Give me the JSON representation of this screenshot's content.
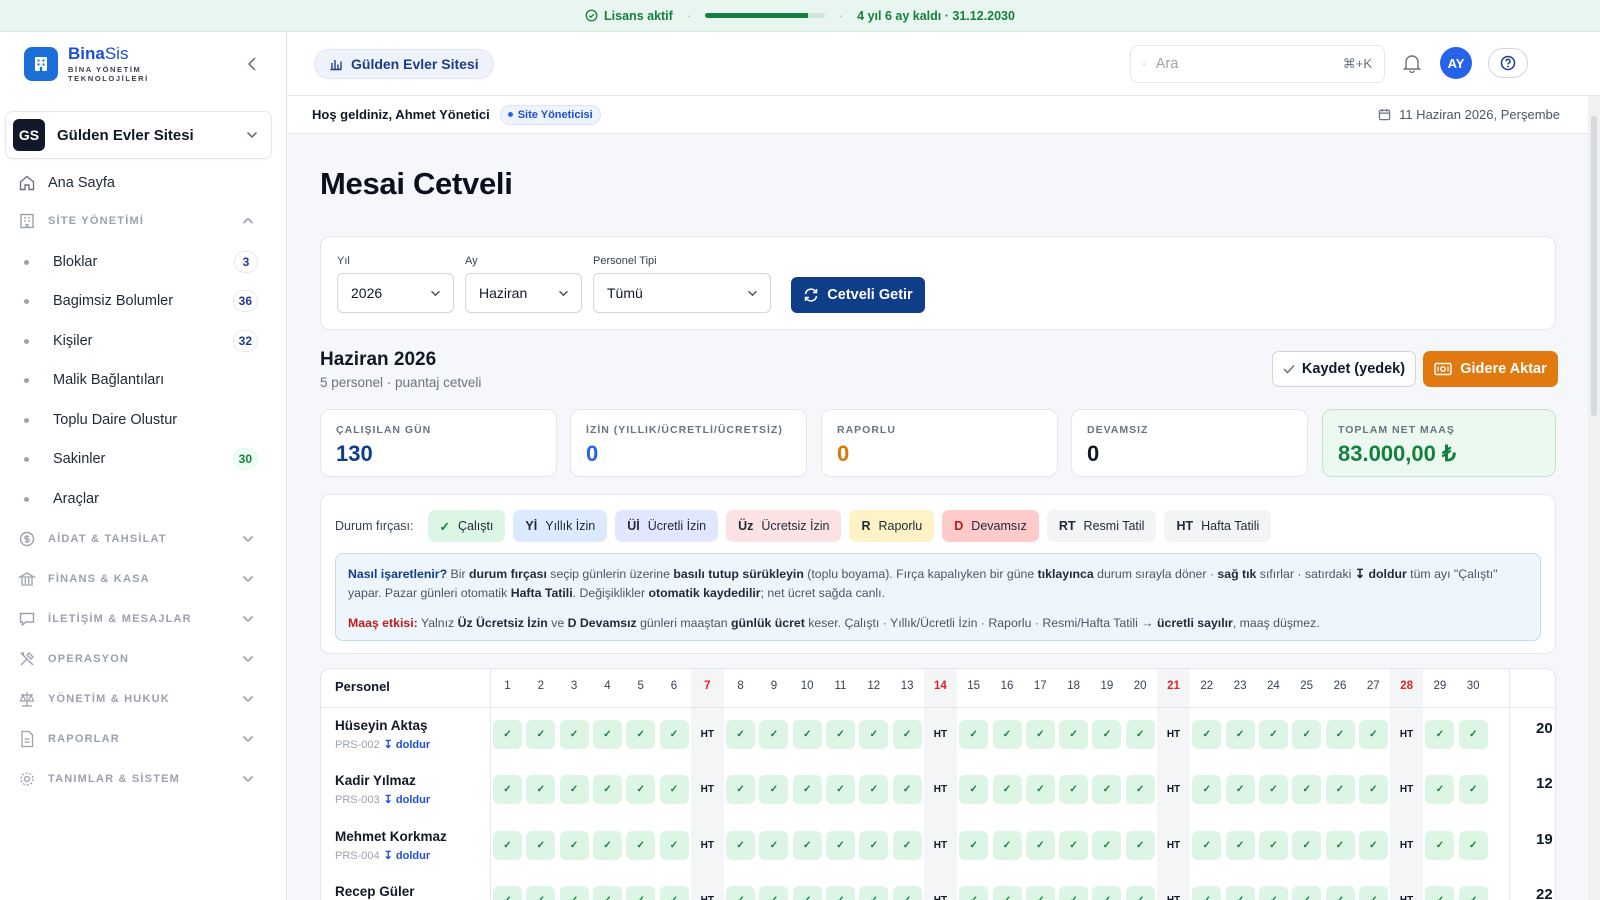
{
  "license": {
    "status": "Lisans aktif",
    "progress": 0.86,
    "remaining": "4 yıl 6 ay kaldı · 31.12.2030"
  },
  "brand": {
    "name_bold": "Bina",
    "name_light": "Sis",
    "tagline": "BİNA YÖNETİM TEKNOLOJİLERİ"
  },
  "site_selector": {
    "initials": "GS",
    "name": "Gülden Evler Sitesi"
  },
  "nav": {
    "home": "Ana Sayfa",
    "site_section": "SİTE YÖNETİMİ",
    "site_items": [
      {
        "label": "Bloklar",
        "count": "3"
      },
      {
        "label": "Bagimsiz Bolumler",
        "count": "36"
      },
      {
        "label": "Kişiler",
        "count": "32"
      },
      {
        "label": "Malik Bağlantıları",
        "count": ""
      },
      {
        "label": "Toplu Daire Olustur",
        "count": ""
      },
      {
        "label": "Sakinler",
        "count": "30"
      },
      {
        "label": "Araçlar",
        "count": ""
      }
    ],
    "sections": [
      "AİDAT & TAHSİLAT",
      "FİNANS & KASA",
      "İLETİŞİM & MESAJLAR",
      "OPERASYON",
      "YÖNETİM & HUKUK",
      "RAPORLAR",
      "TANIMLAR & SİSTEM"
    ]
  },
  "header": {
    "site_pill": "Gülden Evler Sitesi",
    "search_placeholder": "Ara",
    "search_shortcut": "⌘+K",
    "avatar": "AY"
  },
  "subheader": {
    "welcome": "Hoş geldiniz, Ahmet Yönetici",
    "role": "Site Yöneticisi",
    "date": "11 Haziran 2026, Perşembe"
  },
  "page": {
    "title": "Mesai Cetveli"
  },
  "filters": {
    "year_label": "Yıl",
    "year_value": "2026",
    "month_label": "Ay",
    "month_value": "Haziran",
    "type_label": "Personel Tipi",
    "type_value": "Tümü",
    "fetch_button": "Cetveli Getir"
  },
  "period": {
    "title": "Haziran 2026",
    "subtitle": "5 personel · puantaj cetveli",
    "save_button": "Kaydet (yedek)",
    "expense_button": "Gidere Aktar"
  },
  "stats": [
    {
      "label": "ÇALIŞILAN GÜN",
      "value": "130",
      "color": "#0f3d88"
    },
    {
      "label": "İZİN (YILLIK/ÜCRETLİ/ÜCRETSİZ)",
      "value": "0",
      "color": "#2563eb"
    },
    {
      "label": "RAPORLU",
      "value": "0",
      "color": "#d97706"
    },
    {
      "label": "DEVAMSIZ",
      "value": "0",
      "color": "#111827"
    },
    {
      "label": "TOPLAM NET MAAŞ",
      "value": "83.000,00 ₺",
      "color": "#15803d"
    }
  ],
  "brush": {
    "label": "Durum fırçası:",
    "chips": [
      {
        "code": "✓",
        "text": "Çalıştı",
        "bg": "#dcf5e4"
      },
      {
        "code": "Yİ",
        "text": "Yıllık İzin",
        "bg": "#dbeafe"
      },
      {
        "code": "Üİ",
        "text": "Ücretli İzin",
        "bg": "#e0e7ff"
      },
      {
        "code": "Üz",
        "text": "Ücretsiz İzin",
        "bg": "#fde2e4"
      },
      {
        "code": "R",
        "text": "Raporlu",
        "bg": "#fef3c7"
      },
      {
        "code": "D",
        "text": "Devamsız",
        "bg": "#fecaca"
      },
      {
        "code": "RT",
        "text": "Resmi Tatil",
        "bg": "#f3f4f6"
      },
      {
        "code": "HT",
        "text": "Hafta Tatili",
        "bg": "#f3f4f6"
      }
    ]
  },
  "help": {
    "q": "Nasıl işaretlenir?",
    "t1": " Bir ",
    "b1": "durum fırçası",
    "t2": " seçip günlerin üzerine ",
    "b2": "basılı tutup sürükleyin",
    "t3": " (toplu boyama). Fırça kapalıyken bir güne ",
    "b3": "tıklayınca",
    "t4": " durum sırayla döner · ",
    "b4": "sağ tık",
    "t5": " sıfırlar · satırdaki ",
    "b5": "↧ doldur",
    "t6": " tüm ayı \"Çalıştı\" yapar. Pazar günleri otomatik ",
    "b6": "Hafta Tatili",
    "t7": ". Değişiklikler ",
    "b7": "otomatik kaydedilir",
    "t8": "; net ücret sağda canlı.",
    "m": "Maaş etkisi:",
    "m1": " Yalnız ",
    "mb1": "Üz Ücretsiz İzin",
    "m2": " ve ",
    "mb2": "D Devamsız",
    "m3": " günleri maaştan ",
    "mb3": "günlük ücret",
    "m4": " keser. Çalıştı · Yıllık/Ücretli İzin · Raporlu · Resmi/Hafta Tatili → ",
    "mb4": "ücretli sayılır",
    "m5": ", maaş düşmez."
  },
  "table": {
    "col_personel": "Personel",
    "days": [
      "1",
      "2",
      "3",
      "4",
      "5",
      "6",
      "7",
      "8",
      "9",
      "10",
      "11",
      "12",
      "13",
      "14",
      "15",
      "16",
      "17",
      "18",
      "19",
      "20",
      "21",
      "22",
      "23",
      "24",
      "25",
      "26",
      "27",
      "28",
      "29",
      "30"
    ],
    "sundays": [
      7,
      14,
      21,
      28
    ],
    "fill_label": "↧ doldur",
    "check": "✓",
    "ht": "HT",
    "rows": [
      {
        "name": "Hüseyin Aktaş",
        "code": "PRS-002",
        "total": "20"
      },
      {
        "name": "Kadir Yılmaz",
        "code": "PRS-003",
        "total": "12"
      },
      {
        "name": "Mehmet Korkmaz",
        "code": "PRS-004",
        "total": "19"
      },
      {
        "name": "Recep Güler",
        "code": "",
        "total": "22"
      }
    ]
  },
  "colors": {
    "primary": "#0f3d88",
    "accent_orange": "#e07a10",
    "success": "#15803d",
    "brand_blue": "#1d6fd8"
  }
}
